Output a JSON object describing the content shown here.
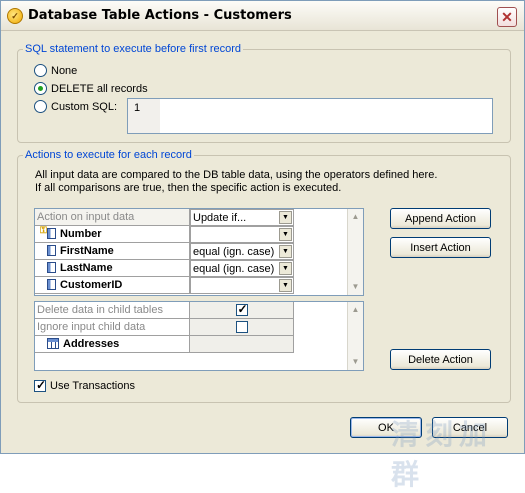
{
  "window": {
    "title": "Database Table Actions - Customers",
    "close_glyph": "✕"
  },
  "sql_section": {
    "legend": "SQL statement to execute before first record",
    "options": [
      {
        "label": "None",
        "selected": false
      },
      {
        "label": "DELETE all records",
        "selected": true
      },
      {
        "label": "Custom SQL:",
        "selected": false
      }
    ],
    "editor_line_number": "1",
    "editor_text": ""
  },
  "actions_section": {
    "legend": "Actions to execute for each record",
    "description_line1": "All input data are compared to the DB table data, using the operators defined here.",
    "description_line2": "If all comparisons are true, then the specific action is executed.",
    "grid1": {
      "header_label": "Action on input data",
      "header_action": "Update if...",
      "rows": [
        {
          "field": "Number",
          "operator": "",
          "is_key": true
        },
        {
          "field": "FirstName",
          "operator": "equal (ign. case)",
          "is_key": false
        },
        {
          "field": "LastName",
          "operator": "equal (ign. case)",
          "is_key": false
        },
        {
          "field": "CustomerID",
          "operator": "",
          "is_key": false
        }
      ]
    },
    "grid2": {
      "rows": [
        {
          "label": "Delete data in child tables",
          "checked": true
        },
        {
          "label": "Ignore input child data",
          "checked": false
        }
      ],
      "child_table": "Addresses"
    },
    "buttons": {
      "append": "Append Action",
      "insert": "Insert Action",
      "delete": "Delete Action"
    }
  },
  "use_transactions": {
    "label": "Use Transactions",
    "checked": true
  },
  "footer": {
    "ok": "OK",
    "cancel": "Cancel"
  },
  "watermark_text": "清刻加群"
}
